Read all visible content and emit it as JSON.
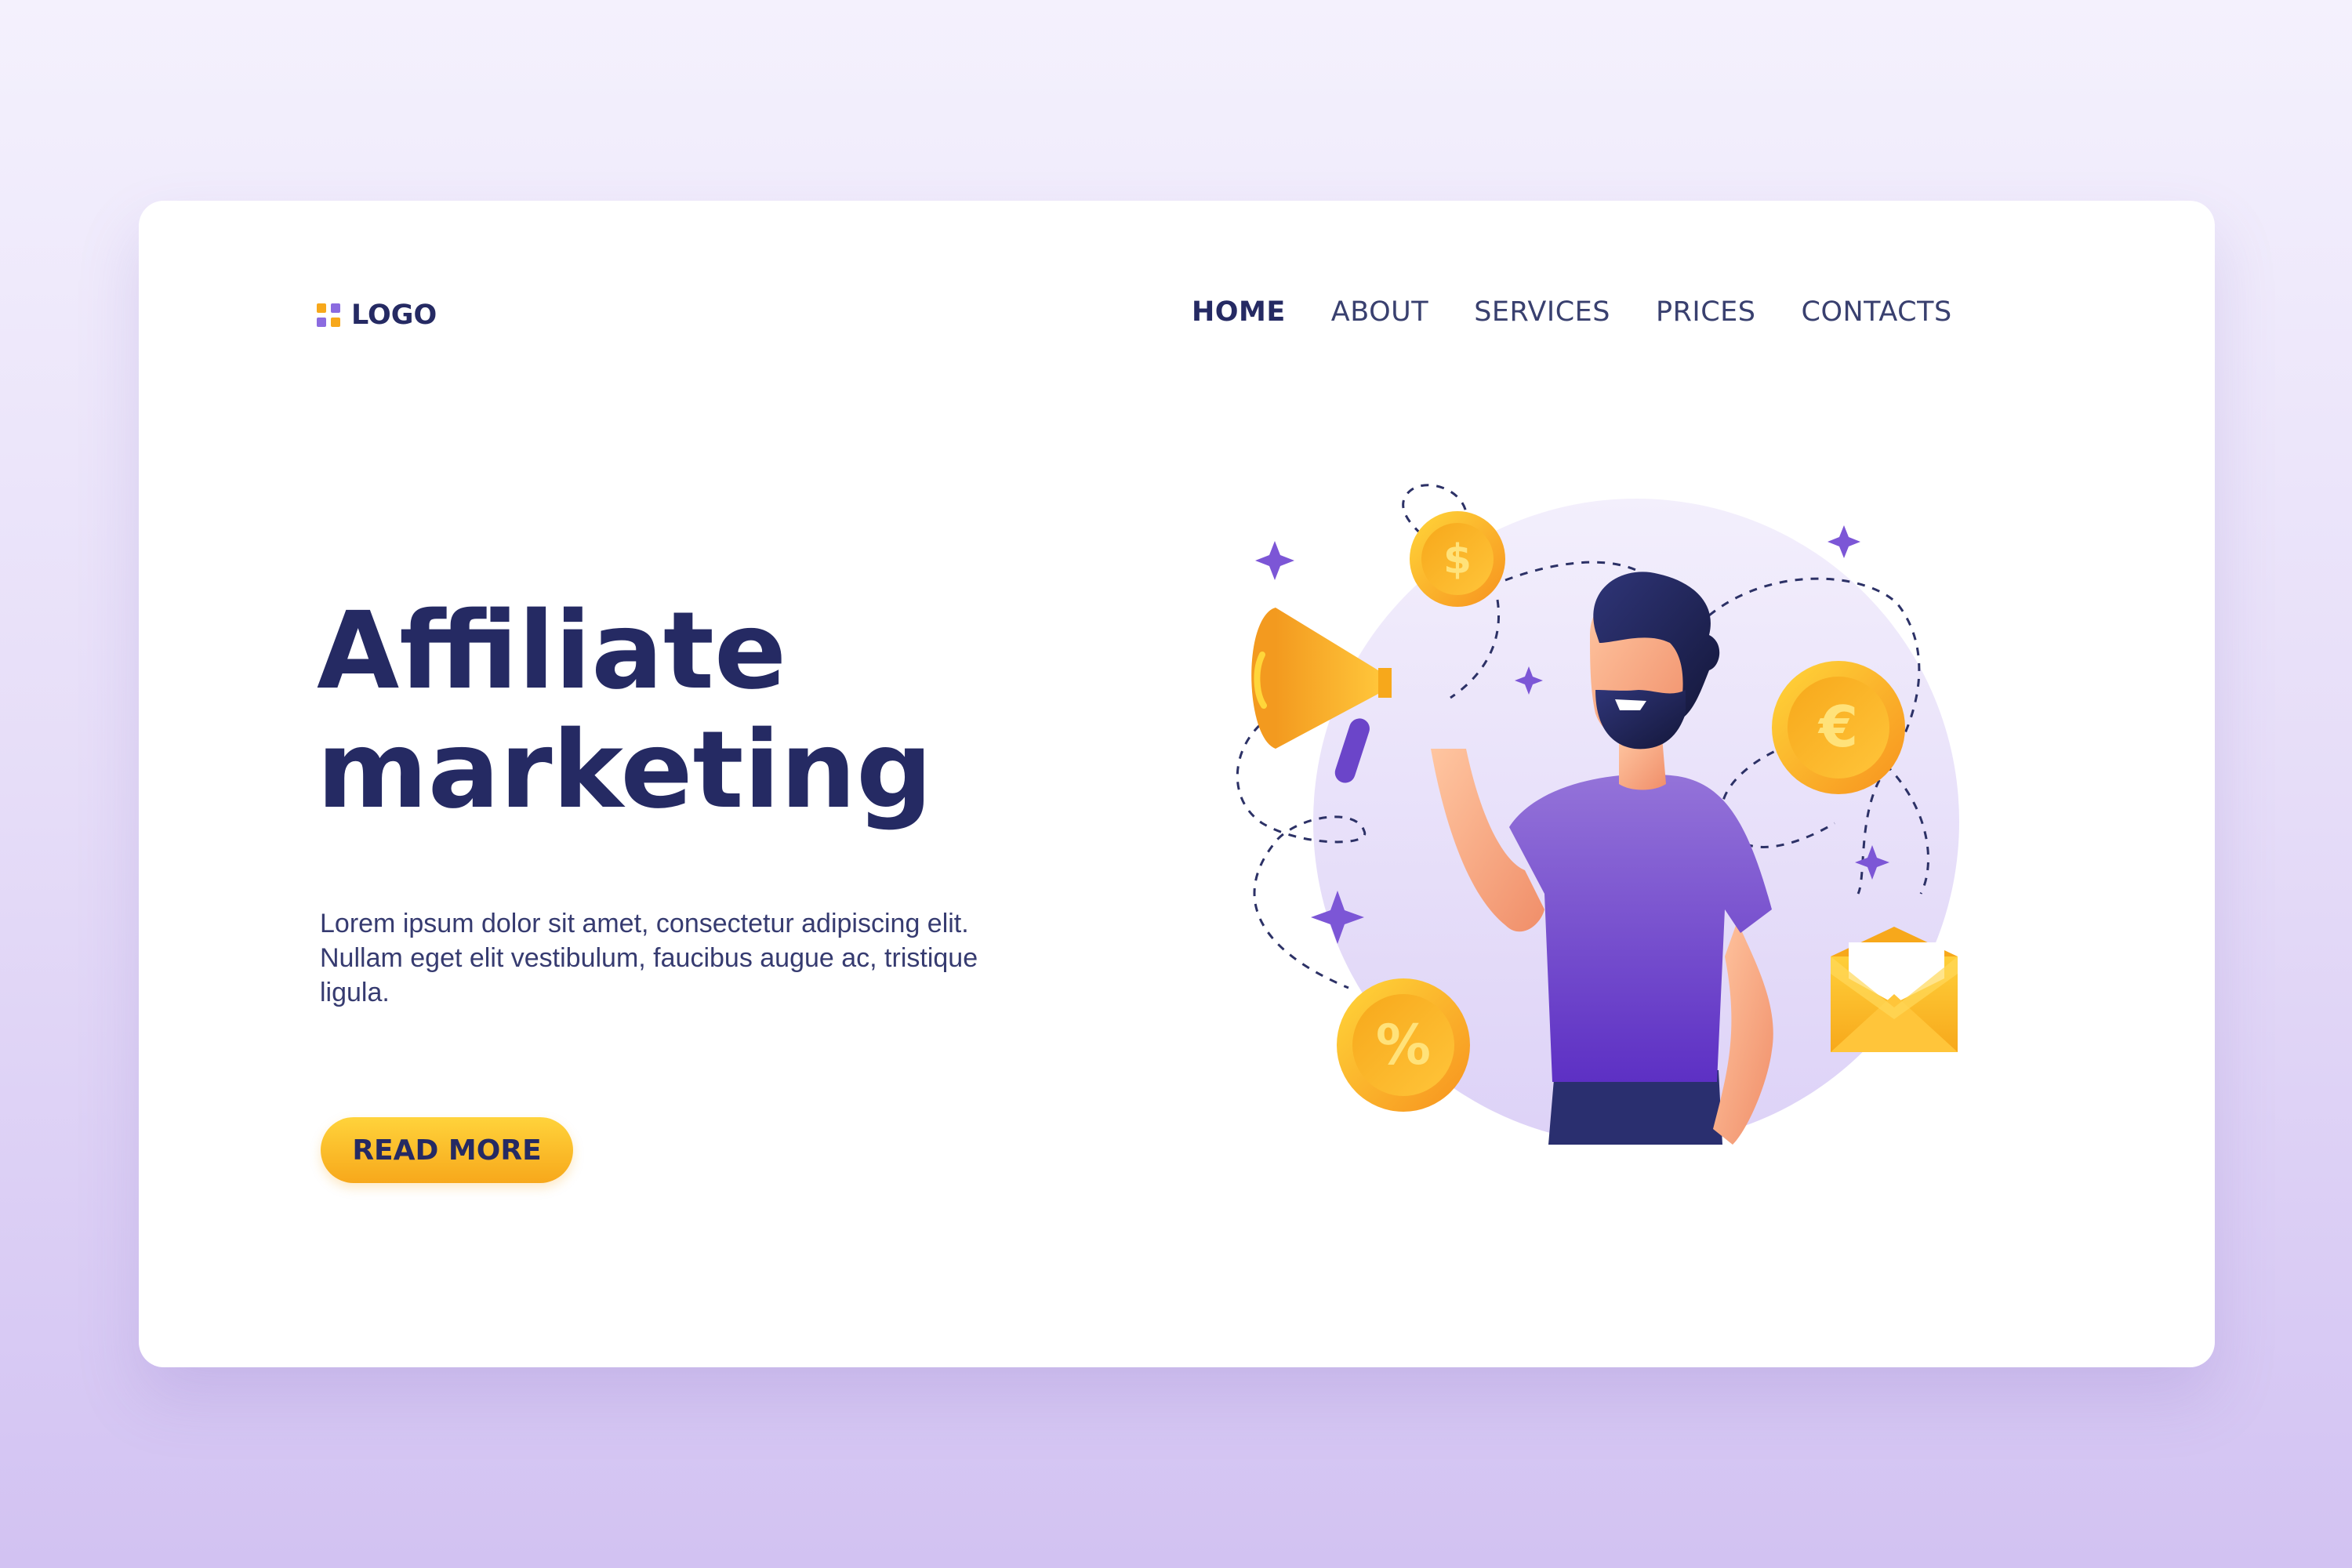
{
  "logo": {
    "text": "LOGO"
  },
  "nav": {
    "items": [
      {
        "label": "HOME",
        "active": true
      },
      {
        "label": "ABOUT"
      },
      {
        "label": "SERVICES"
      },
      {
        "label": "PRICES"
      },
      {
        "label": "CONTACTS"
      }
    ]
  },
  "hero": {
    "title_line1": "Affiliate",
    "title_line2": "marketing",
    "description": "Lorem ipsum dolor sit amet, consectetur adipiscing elit. Nullam eget elit vestibulum, faucibus augue ac, tristique ligula.",
    "button_label": "READ MORE"
  },
  "illustration": {
    "coins": [
      "$",
      "€",
      "%"
    ],
    "icons": [
      "megaphone-icon",
      "envelope-icon",
      "sparkle-icon",
      "coin-icon"
    ]
  },
  "colors": {
    "brand": "#252a63",
    "accent": "#f7a81b",
    "purple": "#7c56d6",
    "background": "#e6ddf8"
  }
}
